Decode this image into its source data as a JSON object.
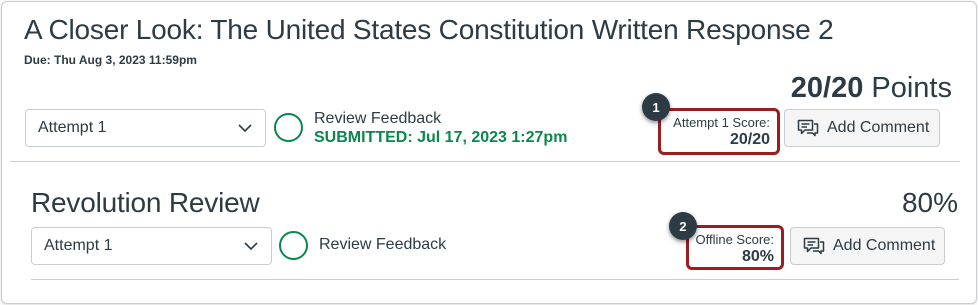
{
  "assignments": [
    {
      "title": "A Closer Look: The United States Constitution Written Response 2",
      "due": "Due: Thu Aug 3, 2023 11:59pm",
      "points_value": "20/20",
      "points_unit": "Points",
      "attempt_select": "Attempt 1",
      "feedback_label": "Review Feedback",
      "submitted_status": "SUBMITTED: Jul 17, 2023 1:27pm",
      "score_label": "Attempt 1 Score:",
      "score_value": "20/20",
      "comment_button": "Add Comment",
      "marker": "1"
    },
    {
      "title": "Revolution Review",
      "grade": "80%",
      "attempt_select": "Attempt 1",
      "feedback_label": "Review Feedback",
      "score_label": "Offline Score:",
      "score_value": "80%",
      "comment_button": "Add Comment",
      "marker": "2"
    }
  ],
  "colors": {
    "text": "#2d3b45",
    "success_green": "#0b874b",
    "highlight_red": "#9b1d20",
    "border": "#c7cdd1",
    "button_bg": "#f5f5f5"
  },
  "icons": [
    "chevron-down-icon",
    "feedback-status-circle-icon",
    "comment-icon"
  ]
}
